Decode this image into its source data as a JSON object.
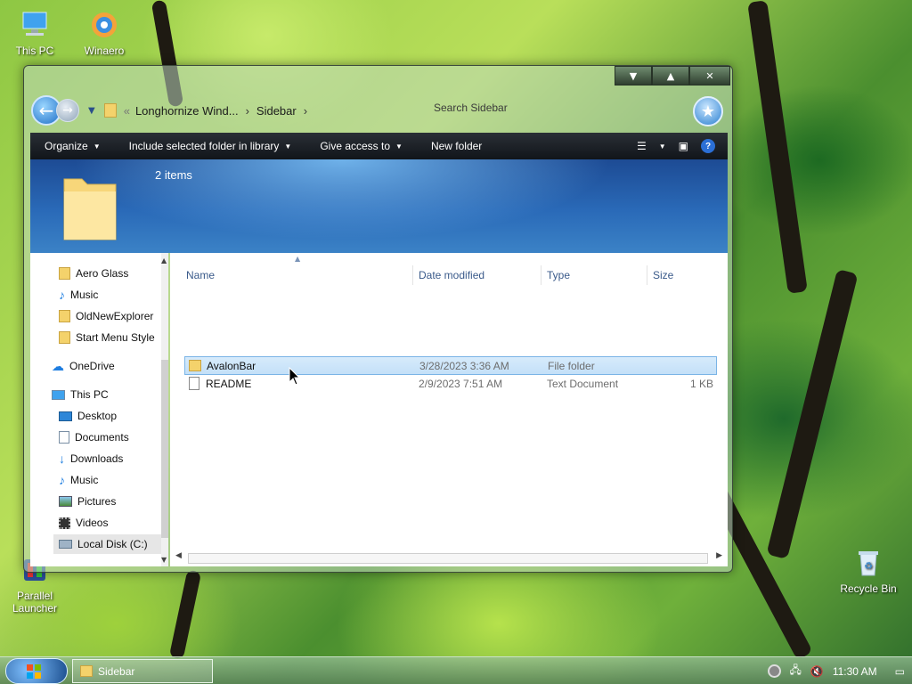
{
  "desktop": {
    "icons": [
      {
        "label": "This PC"
      },
      {
        "label": "Winaero"
      },
      {
        "label": "Parallel Launcher"
      },
      {
        "label": "Recycle Bin"
      }
    ]
  },
  "window": {
    "breadcrumb": [
      "Longhornize Wind...",
      "Sidebar"
    ],
    "search_placeholder": "Search Sidebar",
    "toolbar": {
      "organize": "Organize",
      "include": "Include selected folder in library",
      "give_access": "Give access to",
      "new_folder": "New folder"
    },
    "banner": {
      "item_count": "2 items"
    },
    "nav": [
      {
        "label": "Aero Glass",
        "icon": "folder-icon"
      },
      {
        "label": "Music",
        "icon": "music-note-icon"
      },
      {
        "label": "OldNewExplorer",
        "icon": "folder-icon"
      },
      {
        "label": "Start Menu Style",
        "icon": "folder-icon"
      },
      {
        "label": "OneDrive",
        "icon": "cloud-icon"
      },
      {
        "label": "This PC",
        "icon": "computer-icon"
      },
      {
        "label": "Desktop",
        "icon": "desktop-icon"
      },
      {
        "label": "Documents",
        "icon": "document-icon"
      },
      {
        "label": "Downloads",
        "icon": "download-icon"
      },
      {
        "label": "Music",
        "icon": "music-note-icon"
      },
      {
        "label": "Pictures",
        "icon": "pictures-icon"
      },
      {
        "label": "Videos",
        "icon": "videos-icon"
      },
      {
        "label": "Local Disk (C:)",
        "icon": "drive-icon"
      }
    ],
    "columns": [
      "Name",
      "Date modified",
      "Type",
      "Size"
    ],
    "files": [
      {
        "name": "AvalonBar",
        "date": "3/28/2023 3:36 AM",
        "type": "File folder",
        "size": ""
      },
      {
        "name": "README",
        "date": "2/9/2023 7:51 AM",
        "type": "Text Document",
        "size": "1 KB"
      }
    ]
  },
  "taskbar": {
    "task_label": "Sidebar",
    "clock": "11:30 AM"
  }
}
